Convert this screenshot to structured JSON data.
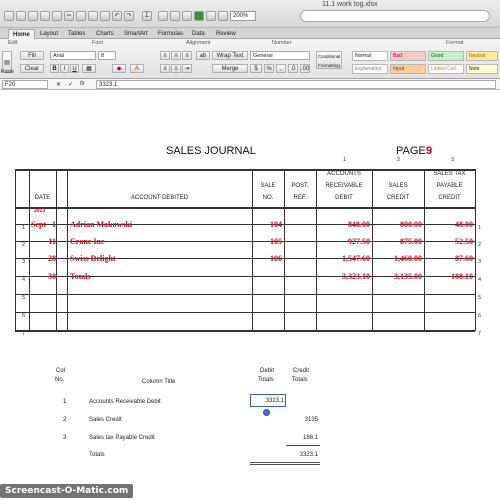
{
  "window": {
    "title": "11.1 work tog.xlsx"
  },
  "toolbar": {
    "zoom": "200%"
  },
  "ribbon": {
    "tabs": [
      "Home",
      "Layout",
      "Tables",
      "Charts",
      "SmartArt",
      "Formulas",
      "Data",
      "Review"
    ],
    "active_tab": "Home",
    "groups": {
      "edit": "Edit",
      "font": "Font",
      "alignment": "Alignment",
      "number": "Number",
      "format": "Format"
    },
    "fill_label": "Fill",
    "clear_label": "Clear",
    "font_name": "Arial",
    "font_size": "8",
    "wrap_label": "Wrap Text",
    "merge_label": "Merge",
    "number_format": "General",
    "conditional_formatting": "Conditional Formatting",
    "paste_label": "Paste",
    "styles": {
      "normal": "Normal",
      "bad": "Bad",
      "good": "Good",
      "neutral": "Neutral",
      "explanatory": "Explanatory...",
      "input": "Input",
      "linked_cell": "Linked Cell",
      "note": "Note"
    }
  },
  "formula_bar": {
    "cell_ref": "F20",
    "content": "3323.1"
  },
  "journal": {
    "title": "SALES JOURNAL",
    "page_label": "PAGE",
    "page_number": "9",
    "column_numbers": [
      "1",
      "2",
      "3"
    ],
    "headers": {
      "date": "DATE",
      "account": "ACCOUNT DEBITED",
      "sale_no_1": "SALE",
      "sale_no_2": "NO.",
      "post_ref_1": "POST.",
      "post_ref_2": "REF.",
      "ar_1": "ACCOUNTS",
      "ar_2": "RECEIVABLE",
      "ar_3": "DEBIT",
      "sales_1": "SALES",
      "sales_2": "CREDIT",
      "tax_1": "SALES TAX",
      "tax_2": "PAYABLE",
      "tax_3": "CREDIT"
    },
    "year": "2013",
    "rows": [
      {
        "num": "1",
        "month": "Sept",
        "day": "1",
        "account": "Adrian Makowski",
        "sale_no": "104",
        "ar": "848.00",
        "sales": "800.00",
        "tax": "48.00"
      },
      {
        "num": "2",
        "month": "",
        "day": "11",
        "account": "Crane Inc",
        "sale_no": "105",
        "ar": "927.50",
        "sales": "875.00",
        "tax": "52.50"
      },
      {
        "num": "3",
        "month": "",
        "day": "28",
        "account": "Swiss Delight",
        "sale_no": "106",
        "ar": "1,547.60",
        "sales": "1,460.00",
        "tax": "87.60"
      },
      {
        "num": "4",
        "month": "",
        "day": "30",
        "account": "Totals",
        "sale_no": "",
        "ar": "3,323.10",
        "sales": "3,135.00",
        "tax": "188.10"
      },
      {
        "num": "5",
        "month": "",
        "day": "",
        "account": "",
        "sale_no": "",
        "ar": "",
        "sales": "",
        "tax": ""
      },
      {
        "num": "6",
        "month": "",
        "day": "",
        "account": "",
        "sale_no": "",
        "ar": "",
        "sales": "",
        "tax": ""
      },
      {
        "num": "7",
        "month": "",
        "day": "",
        "account": "",
        "sale_no": "",
        "ar": "",
        "sales": "",
        "tax": ""
      }
    ]
  },
  "summary": {
    "headers": {
      "col_no_1": "Col",
      "col_no_2": "No.",
      "title": "Column Title",
      "debit_1": "Debit",
      "debit_2": "Totals",
      "credit_1": "Credit",
      "credit_2": "Totals"
    },
    "rows": [
      {
        "col": "1",
        "title": "Accounts Receivable Debit",
        "debit": "3323.1",
        "credit": ""
      },
      {
        "col": "2",
        "title": "Sales Credit",
        "debit": "",
        "credit": "3135"
      },
      {
        "col": "3",
        "title": "Sales tax Payable Credit",
        "debit": "",
        "credit": "188.1"
      },
      {
        "col": "",
        "title": "Totals",
        "debit": "",
        "credit": "3323.1"
      }
    ]
  },
  "watermark": "Screencast-O-Matic.com"
}
